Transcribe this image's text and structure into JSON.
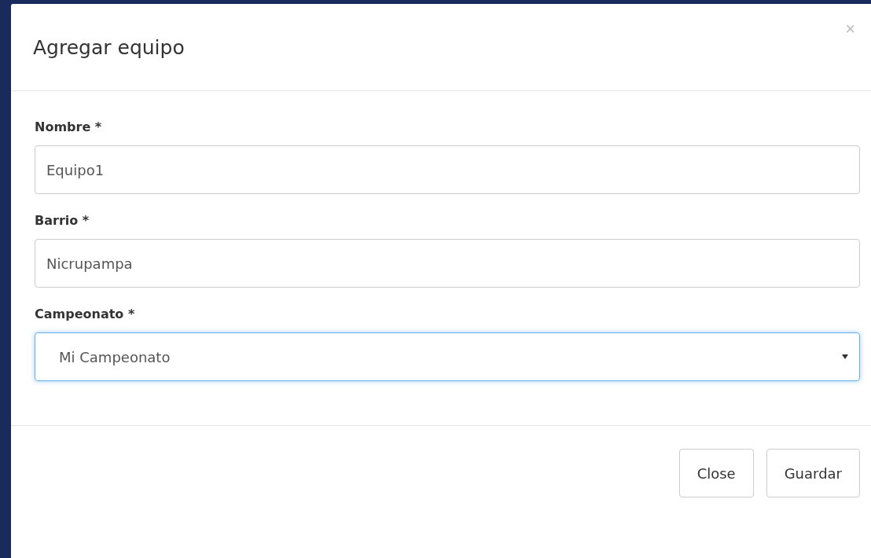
{
  "modal": {
    "title": "Agregar equipo",
    "close_icon": "×"
  },
  "fields": [
    {
      "kind": "text",
      "label": "Nombre *",
      "value": "Equipo1",
      "focused": false
    },
    {
      "kind": "text",
      "label": "Barrio *",
      "value": "Nicrupampa",
      "focused": false
    },
    {
      "kind": "select",
      "label": "Campeonato *",
      "value": "Mi Campeonato",
      "focused": true
    }
  ],
  "buttons": [
    "Close",
    "Guardar"
  ]
}
